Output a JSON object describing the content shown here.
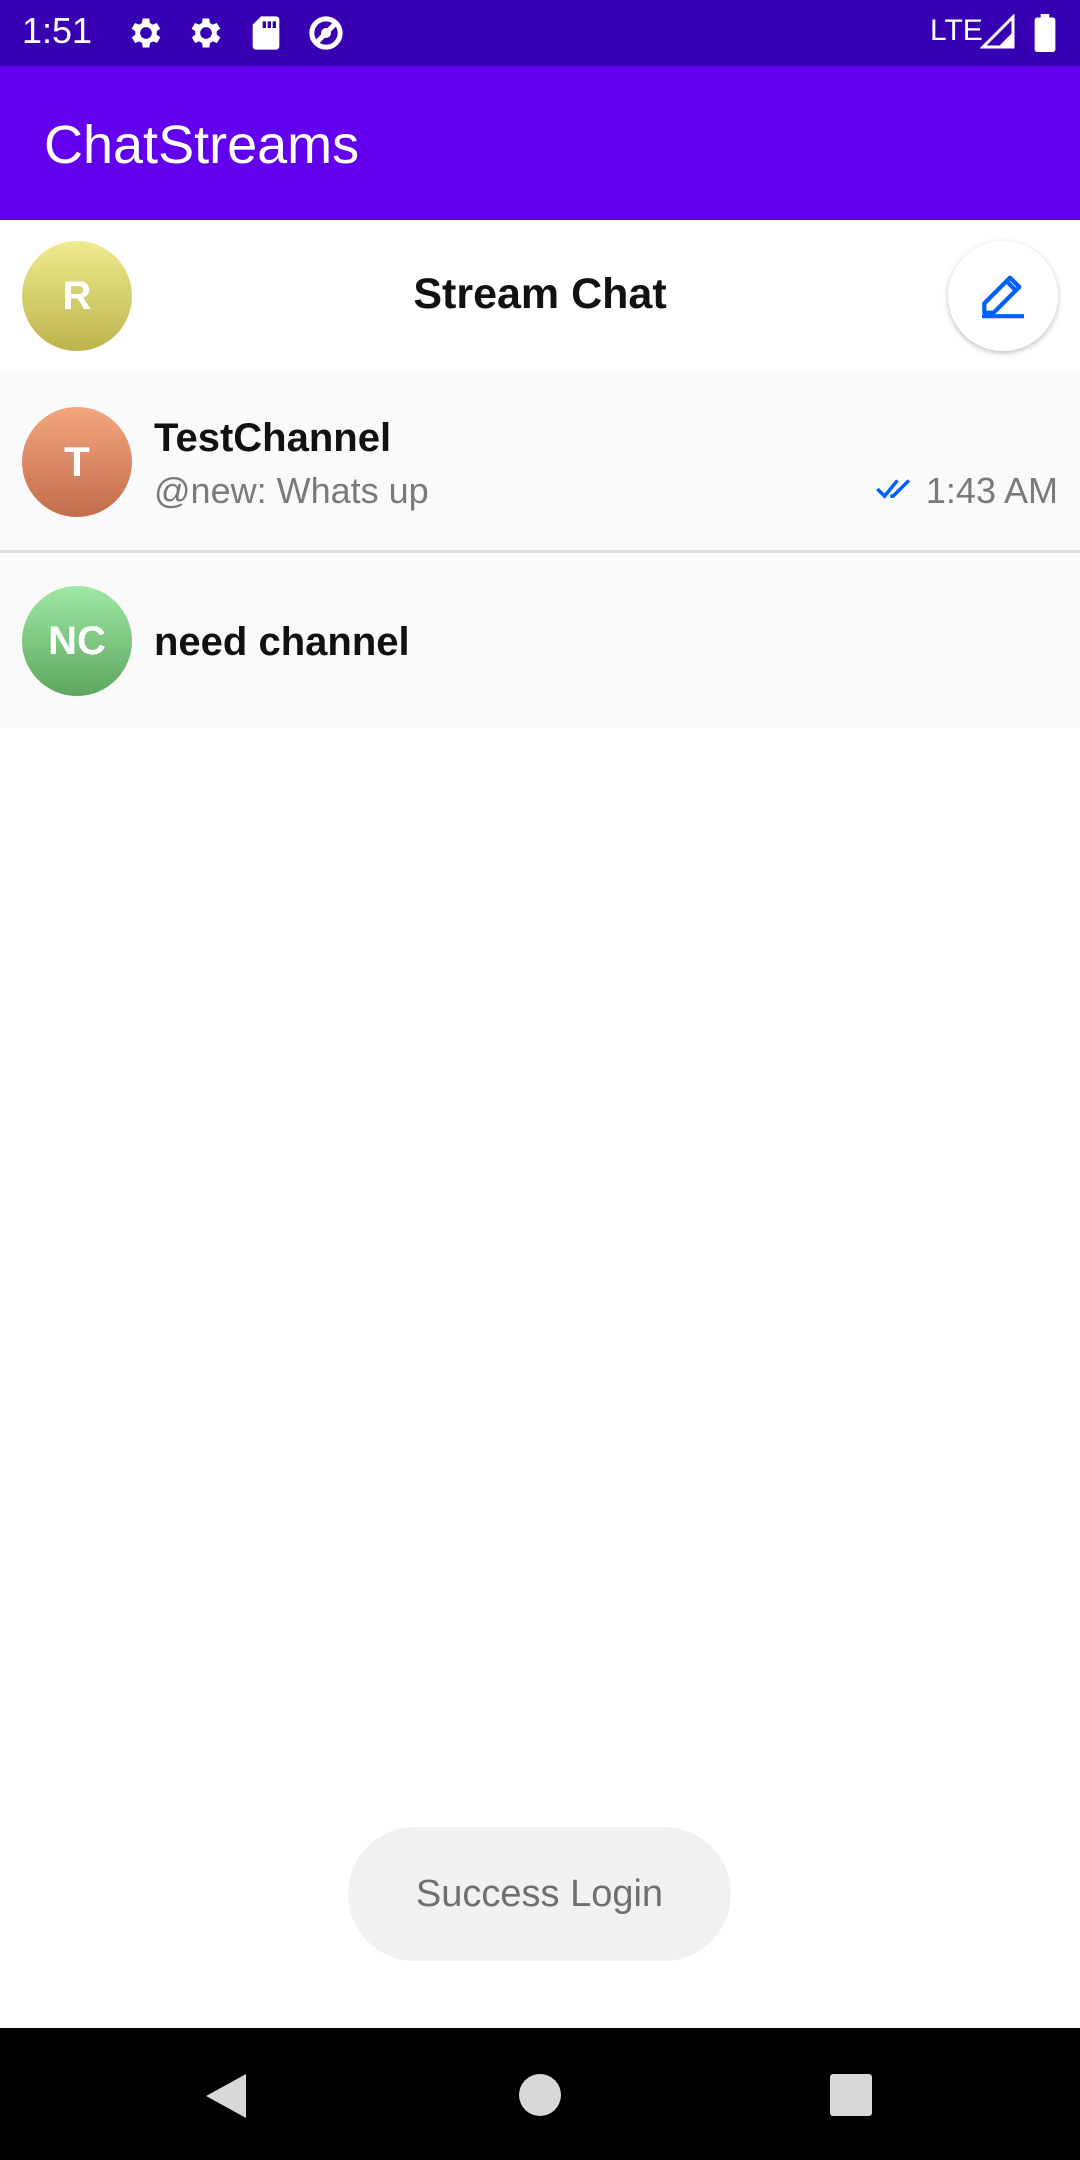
{
  "status_bar": {
    "time": "1:51",
    "network": "LTE",
    "icons": [
      "settings-icon",
      "settings-icon",
      "sd-card-icon",
      "data-saver-icon",
      "signal-icon",
      "battery-icon"
    ]
  },
  "app_bar": {
    "title": "ChatStreams"
  },
  "chat_header": {
    "avatar_initial": "R",
    "title": "Stream Chat",
    "compose_icon": "pencil-icon"
  },
  "channels": [
    {
      "avatar_initials": "T",
      "name": "TestChannel",
      "preview": "@new: Whats up",
      "time": "1:43 AM",
      "read_status_icon": "double-check-icon"
    },
    {
      "avatar_initials": "NC",
      "name": "need channel"
    }
  ],
  "toast": {
    "message": "Success Login"
  },
  "colors": {
    "status_bar": "#3700b3",
    "app_bar": "#6200ee",
    "accent_blue": "#005fff"
  }
}
